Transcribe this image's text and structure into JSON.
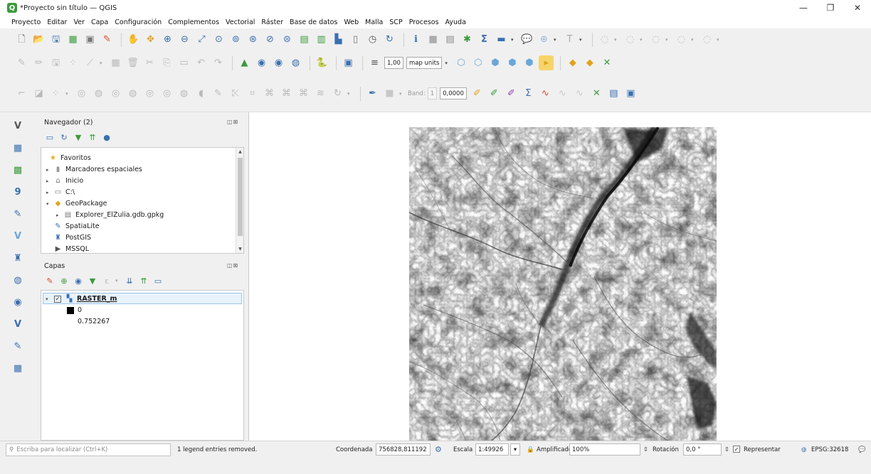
{
  "window": {
    "title": "*Proyecto sin título — QGIS",
    "logo_letter": "Q",
    "minimize": "—",
    "restore": "❐",
    "close": "✕"
  },
  "menu": [
    "Proyecto",
    "Editar",
    "Ver",
    "Capa",
    "Configuración",
    "Complementos",
    "Vectorial",
    "Ráster",
    "Base de datos",
    "Web",
    "Malla",
    "SCP",
    "Procesos",
    "Ayuda"
  ],
  "toolbar_attr": {
    "line_width": "1,00",
    "units": "map units"
  },
  "toolbar_raster": {
    "band_label": "Band:",
    "band_value": "1",
    "value": "0,0000"
  },
  "browser": {
    "title": "Navegador (2)",
    "items": [
      {
        "label": "Favoritos",
        "icon": "star-icon"
      },
      {
        "label": "Marcadores espaciales",
        "icon": "bookmark-icon"
      },
      {
        "label": "Inicio",
        "icon": "home-folder-icon"
      },
      {
        "label": "C:\\",
        "icon": "drive-icon"
      },
      {
        "label": "GeoPackage",
        "icon": "geopackage-icon"
      },
      {
        "label": "Explorer_ElZulia.gdb.gpkg",
        "icon": "database-file-icon"
      },
      {
        "label": "SpatiaLite",
        "icon": "spatialite-icon"
      },
      {
        "label": "PostGIS",
        "icon": "postgis-icon"
      },
      {
        "label": "MSSQL",
        "icon": "mssql-icon"
      }
    ]
  },
  "layers": {
    "title": "Capas",
    "layer_name": "RASTER_m",
    "legend_min": "0",
    "legend_max": "0.752267"
  },
  "status": {
    "locator_placeholder": "Escriba para localizar (Ctrl+K)",
    "message": "1 legend entries removed.",
    "coord_label": "Coordenada",
    "coord_value": "756828,811192",
    "scale_label": "Escala",
    "scale_value": "1:49926",
    "magnifier_label": "Amplificador",
    "magnifier_value": "100%",
    "rotation_label": "Rotación",
    "rotation_value": "0,0 °",
    "render_label": "Representar",
    "crs": "EPSG:32618"
  },
  "colors": {
    "accent_green": "#3c9a3c",
    "selection_blue": "#99c4e8"
  }
}
